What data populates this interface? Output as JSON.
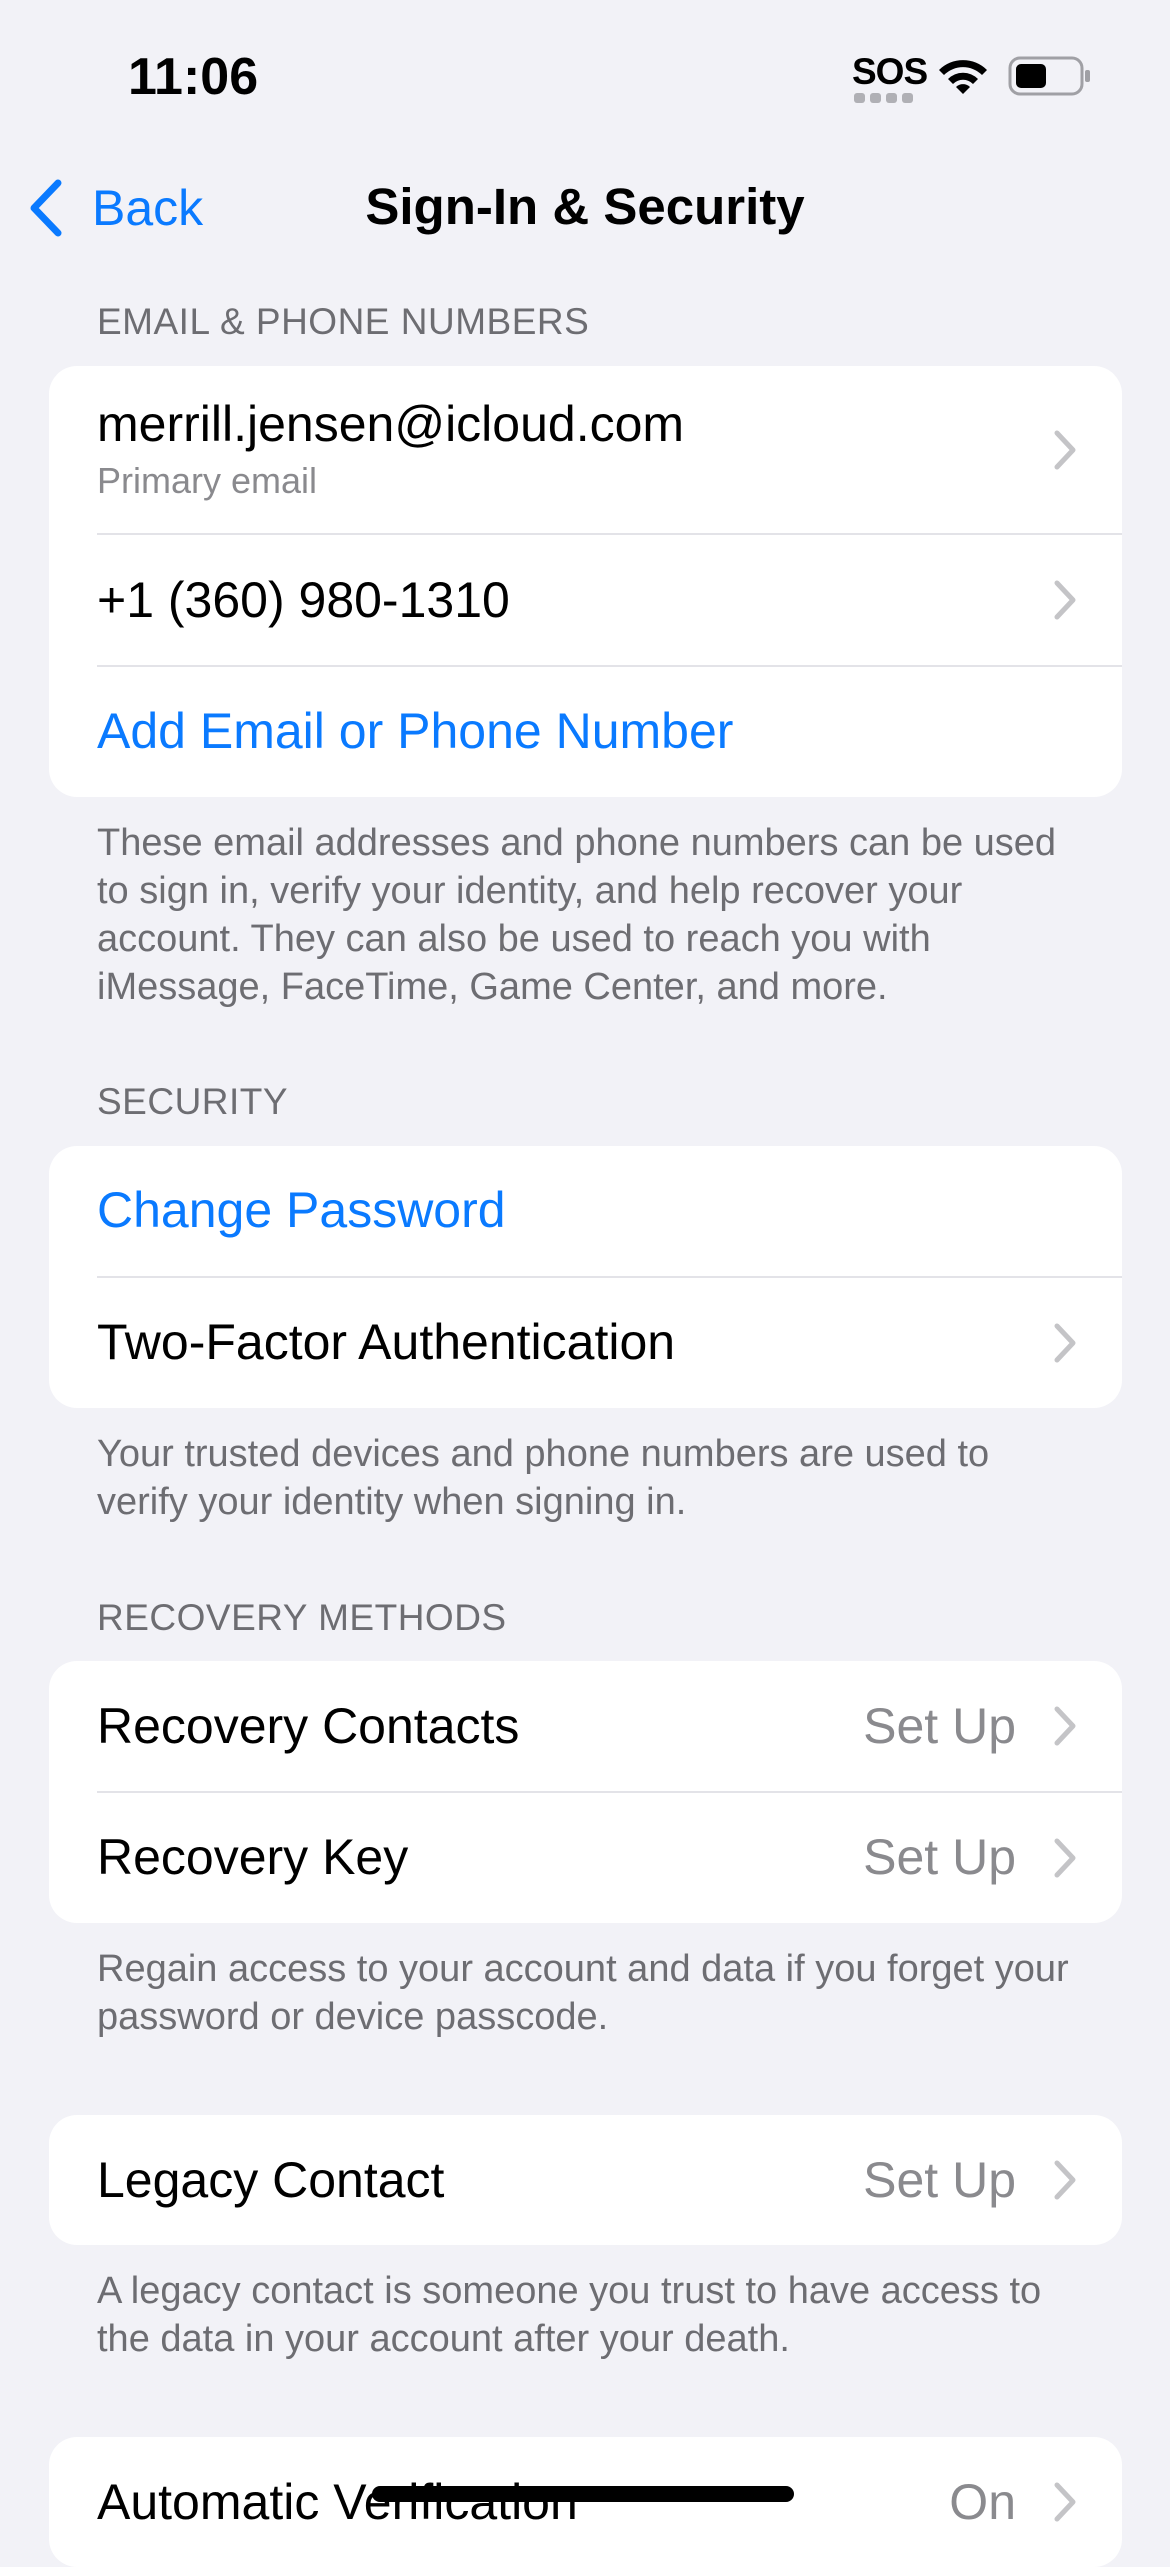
{
  "status_bar": {
    "time": "11:06",
    "sos": "SOS",
    "icons": [
      "wifi-icon",
      "battery-icon"
    ]
  },
  "nav": {
    "back_label": "Back",
    "title": "Sign-In & Security"
  },
  "email_section": {
    "header": "EMAIL & PHONE NUMBERS",
    "email": "merrill.jensen@icloud.com",
    "email_sub": "Primary email",
    "phone": "+1 (360) 980-1310",
    "add_label": "Add Email or Phone Number",
    "footer": "These email addresses and phone numbers can be used to sign in, verify your identity, and help recover your account. They can also be used to reach you with iMessage, FaceTime, Game Center, and more."
  },
  "security_section": {
    "header": "SECURITY",
    "change_password": "Change Password",
    "two_factor": "Two-Factor Authentication",
    "footer": "Your trusted devices and phone numbers are used to verify your identity when signing in."
  },
  "recovery_section": {
    "header": "RECOVERY METHODS",
    "recovery_contacts": "Recovery Contacts",
    "recovery_contacts_value": "Set Up",
    "recovery_key": "Recovery Key",
    "recovery_key_value": "Set Up",
    "footer": "Regain access to your account and data if you forget your password or device passcode."
  },
  "legacy_section": {
    "legacy_contact": "Legacy Contact",
    "legacy_contact_value": "Set Up",
    "footer": "A legacy contact is someone you trust to have access to the data in your account after your death."
  },
  "verification_section": {
    "automatic_verification": "Automatic Verification",
    "automatic_verification_value": "On"
  },
  "colors": {
    "accent": "#0a7aff",
    "background": "#f2f2f7",
    "secondary_text": "#6d6d72"
  }
}
